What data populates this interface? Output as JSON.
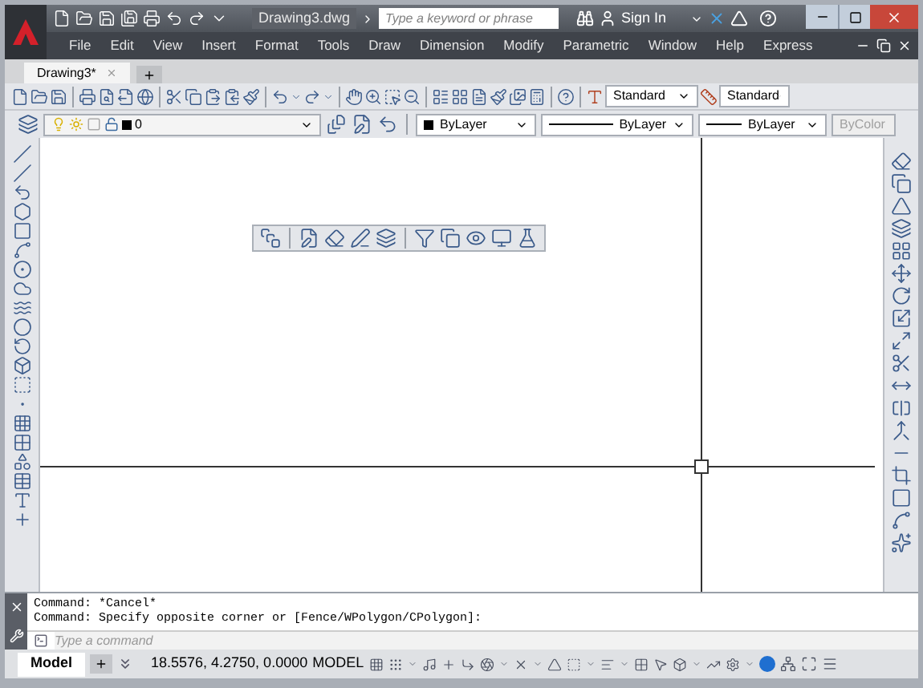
{
  "title_bar": {
    "document_title": "Drawing3.dwg",
    "search": {
      "placeholder": "Type a keyword or phrase"
    },
    "sign_in": "Sign In"
  },
  "menu": [
    "File",
    "Edit",
    "View",
    "Insert",
    "Format",
    "Tools",
    "Draw",
    "Dimension",
    "Modify",
    "Parametric",
    "Window",
    "Help",
    "Express"
  ],
  "tabs": [
    {
      "label": "Drawing3*",
      "selected": true
    }
  ],
  "styles_toolbar": {
    "text_style": "Standard",
    "dim_style": "Standard"
  },
  "layers_toolbar": {
    "layer": "0"
  },
  "properties_toolbar": {
    "color_setting": "ByLayer",
    "linetype": "ByLayer",
    "lineweight": "ByLayer",
    "plot_style": {
      "value": "ByColor",
      "disabled": true
    }
  },
  "command_history": [
    "Command: *Cancel*",
    "Command: Specify opposite corner or [Fence/WPolygon/CPolygon]:"
  ],
  "command_line": {
    "placeholder": "Type a command"
  },
  "status_bar": {
    "layout_tabs": [
      {
        "label": "Model",
        "selected": true
      }
    ],
    "coordinates": "18.5576, 4.2750, 0.0000",
    "space": "MODEL"
  }
}
